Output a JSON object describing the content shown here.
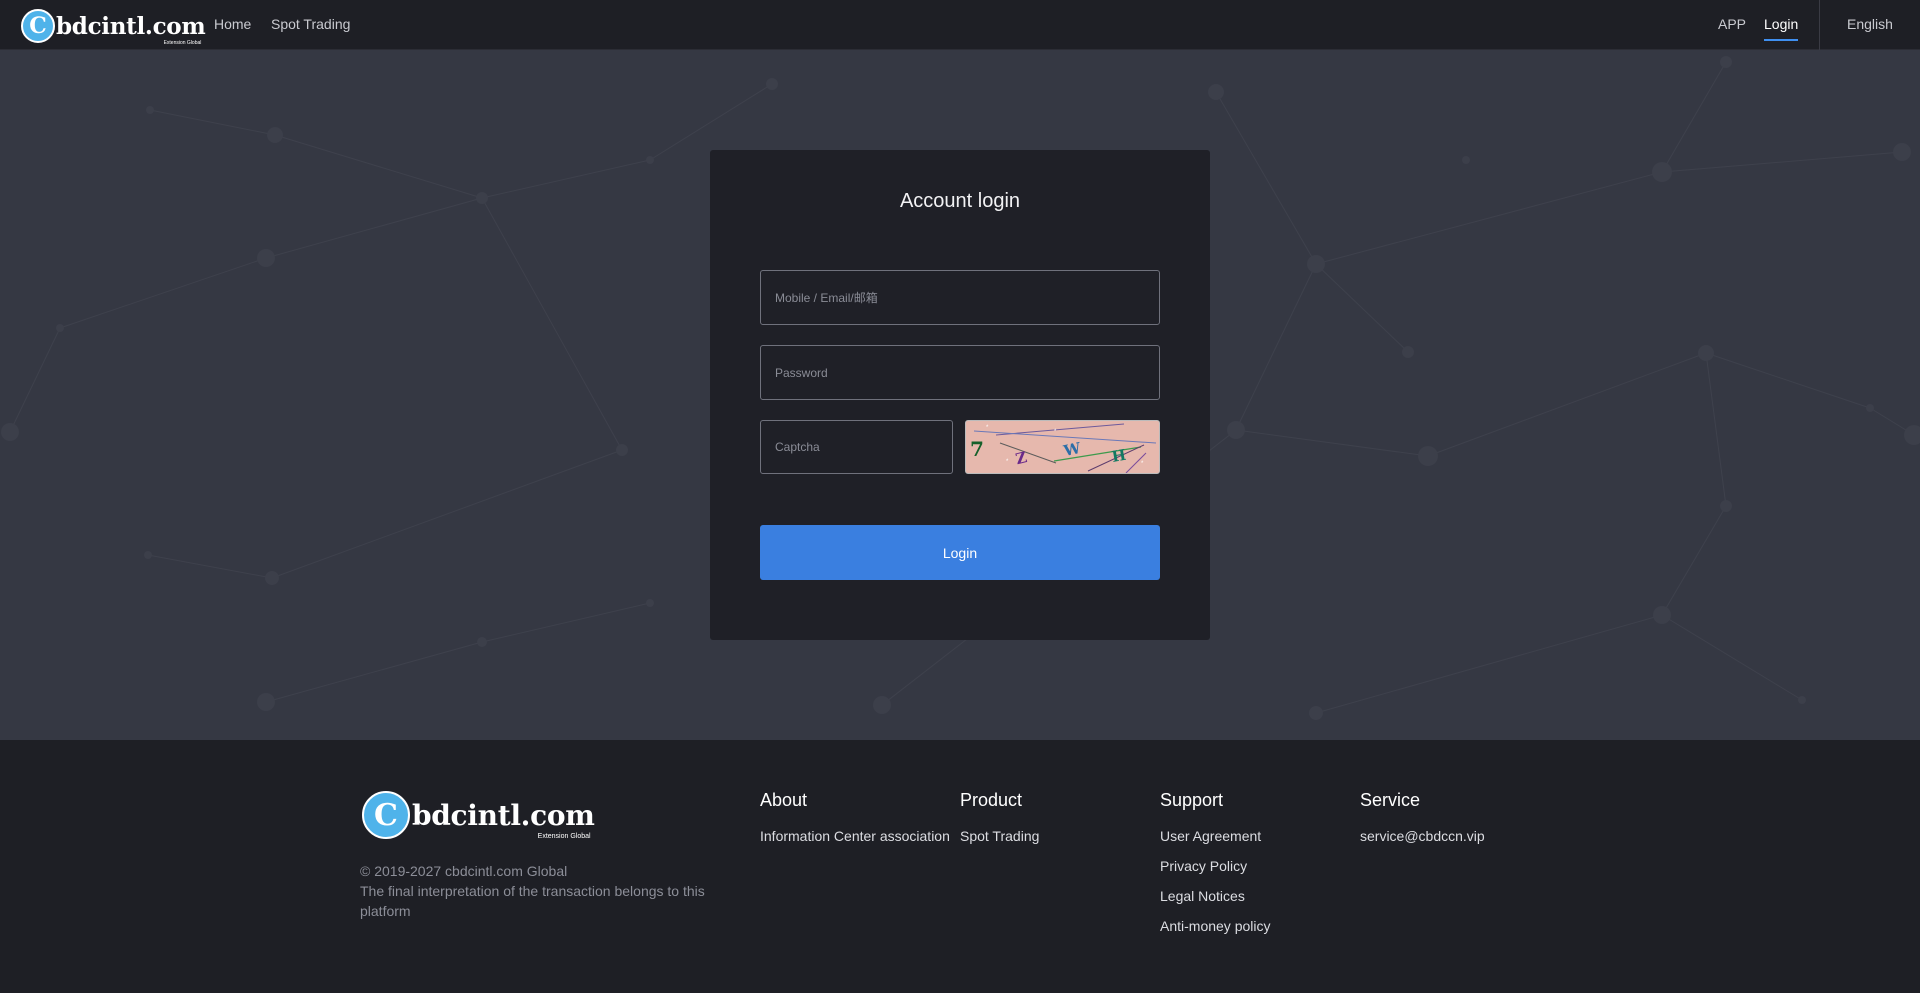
{
  "header": {
    "logo_text": "bdcintl.com",
    "logo_subtext": "Extension Global",
    "nav": {
      "home": "Home",
      "spot_trading": "Spot Trading",
      "app": "APP",
      "login": "Login",
      "language": "English"
    }
  },
  "login_card": {
    "title": "Account login",
    "username_placeholder": "Mobile / Email/邮箱",
    "password_placeholder": "Password",
    "captcha_placeholder": "Captcha",
    "captcha_chars": [
      "7",
      "Z",
      "W",
      "H"
    ],
    "login_button": "Login"
  },
  "footer": {
    "logo_text": "bdcintl.com",
    "logo_subtext": "Extension Global",
    "copyright": "© 2019-2027 cbdcintl.com Global",
    "disclaimer": "The final interpretation of the transaction belongs to this platform",
    "columns": {
      "about": {
        "title": "About",
        "links": [
          "Information Center association"
        ]
      },
      "product": {
        "title": "Product",
        "links": [
          "Spot Trading"
        ]
      },
      "support": {
        "title": "Support",
        "links": [
          "User Agreement",
          "Privacy Policy",
          "Legal Notices",
          "Anti-money policy"
        ]
      },
      "service": {
        "title": "Service",
        "links": [
          "service@cbdccn.vip"
        ]
      }
    }
  },
  "colors": {
    "header_bg": "#1e1f25",
    "hero_bg": "#353843",
    "card_bg": "#1f2027",
    "accent": "#3a7fe0",
    "logo_circle": "#4fb3ea"
  }
}
